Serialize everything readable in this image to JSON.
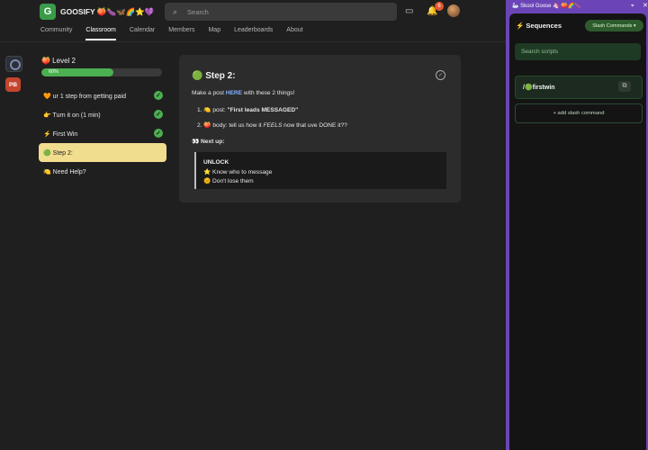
{
  "header": {
    "brand": "GOOSIFY 🍑🍆🦋🌈⭐💜",
    "logo_text": "G",
    "toggle_icon": "chevron-updown-icon",
    "search_placeholder": "Search",
    "notification_count": "6",
    "nav": [
      "Community",
      "Classroom",
      "Calendar",
      "Members",
      "Map",
      "Leaderboards",
      "About"
    ],
    "active_nav": "Classroom"
  },
  "rail": {
    "group_badge": "PB"
  },
  "course": {
    "level": "🍑 Level 2",
    "progress_label": "60%",
    "progress_value": 0.6,
    "lessons": [
      {
        "label": "🧡 ur 1 step from getting paid",
        "done": true
      },
      {
        "label": "👉 Turn it on (1 min)",
        "done": true
      },
      {
        "label": "⚡ First Win",
        "done": true
      },
      {
        "label": "🟢 Step 2:",
        "active": true
      },
      {
        "label": "🍋 Need Help?"
      }
    ]
  },
  "content": {
    "title": "🟢 Step 2:",
    "intro_pre": "Make a post ",
    "intro_link": "HERE",
    "intro_post": " with these 2 things!",
    "item1_pre": "1. 🍋 post: ",
    "item1_bold": "\"First leads MESSAGED\"",
    "item2_pre": "2. 🍑 body: tell us how it ",
    "item2_em": "FEELS",
    "item2_post": " now that uve DONE it??",
    "next_up": "👀 Next up:",
    "quote_title": "UNLOCK",
    "quote_line1": "⭐ Know who to message",
    "quote_line2": "🌞 Don't lose them"
  },
  "extension": {
    "window_title": "🦢 Skool Goose 🦄 🍑🌈🍆",
    "pin_icon": "pin-icon",
    "close_icon": "close-icon",
    "title": "⚡ Sequences",
    "slash_button": "Slash Commands ▾",
    "search_placeholder": "Search scripts",
    "scripts": [
      {
        "name": "/🟢firstwin"
      }
    ],
    "add_label": "+ add slash command"
  },
  "colors": {
    "accent_green": "#4caf50",
    "active_lesson": "#f0dd8e",
    "panel_purple": "#6b45b7",
    "badge_red": "#e4572e"
  }
}
